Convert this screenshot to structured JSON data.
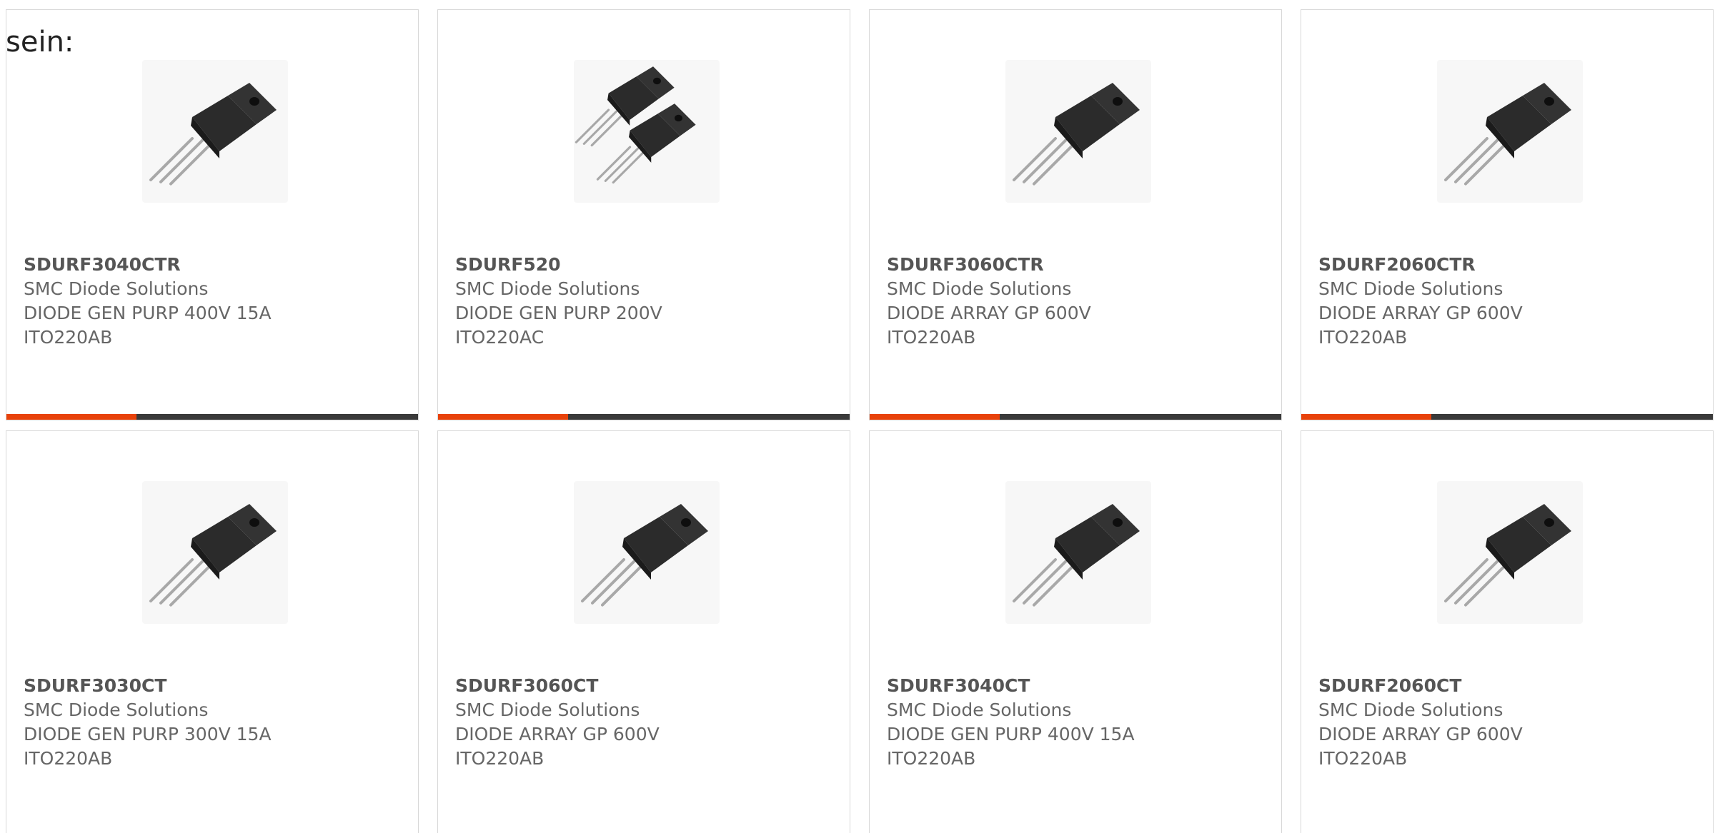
{
  "intro_text": "sein:",
  "colors": {
    "accent": "#e8420a",
    "bar_dark": "#3a3a3a",
    "card_border": "#d8d8d8",
    "text": "#666666"
  },
  "products": [
    {
      "part": "SDURF3040CTR",
      "maker": "SMC Diode Solutions",
      "desc": "DIODE GEN PURP 400V 15A",
      "package": "ITO220AB",
      "image": "to220-single-icon"
    },
    {
      "part": "SDURF520",
      "maker": "SMC Diode Solutions",
      "desc": "DIODE GEN PURP 200V",
      "package": "ITO220AC",
      "image": "to220-double-icon"
    },
    {
      "part": "SDURF3060CTR",
      "maker": "SMC Diode Solutions",
      "desc": "DIODE ARRAY GP 600V",
      "package": "ITO220AB",
      "image": "to220-single-icon"
    },
    {
      "part": "SDURF2060CTR",
      "maker": "SMC Diode Solutions",
      "desc": "DIODE ARRAY GP 600V",
      "package": "ITO220AB",
      "image": "to220-single-icon"
    },
    {
      "part": "SDURF3030CT",
      "maker": "SMC Diode Solutions",
      "desc": "DIODE GEN PURP 300V 15A",
      "package": "ITO220AB",
      "image": "to220-single-icon"
    },
    {
      "part": "SDURF3060CT",
      "maker": "SMC Diode Solutions",
      "desc": "DIODE ARRAY GP 600V",
      "package": "ITO220AB",
      "image": "to220-single-icon"
    },
    {
      "part": "SDURF3040CT",
      "maker": "SMC Diode Solutions",
      "desc": "DIODE GEN PURP 400V 15A",
      "package": "ITO220AB",
      "image": "to220-single-icon"
    },
    {
      "part": "SDURF2060CT",
      "maker": "SMC Diode Solutions",
      "desc": "DIODE ARRAY GP 600V",
      "package": "ITO220AB",
      "image": "to220-single-icon"
    }
  ]
}
